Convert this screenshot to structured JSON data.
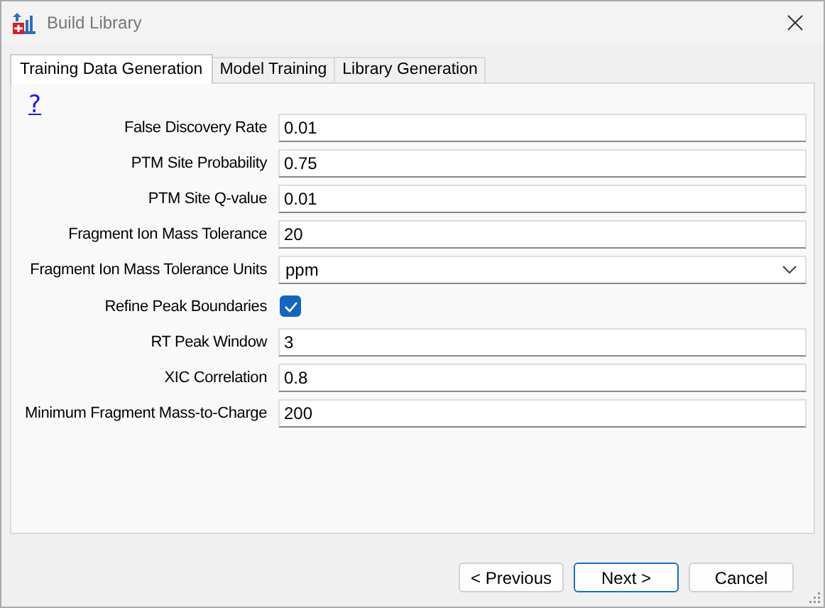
{
  "window": {
    "title": "Build Library"
  },
  "tabs": [
    {
      "label": "Training Data Generation",
      "selected": true
    },
    {
      "label": "Model Training",
      "selected": false
    },
    {
      "label": "Library Generation",
      "selected": false
    }
  ],
  "help_link": "?",
  "fields": [
    {
      "kind": "text",
      "label": "False Discovery Rate",
      "value": "0.01"
    },
    {
      "kind": "text",
      "label": "PTM Site Probability",
      "value": "0.75"
    },
    {
      "kind": "text",
      "label": "PTM Site Q-value",
      "value": "0.01"
    },
    {
      "kind": "text",
      "label": "Fragment Ion Mass Tolerance",
      "value": "20"
    },
    {
      "kind": "dropdown",
      "label": "Fragment Ion Mass Tolerance Units",
      "value": "ppm"
    },
    {
      "kind": "checkbox",
      "label": "Refine Peak Boundaries",
      "checked": true
    },
    {
      "kind": "text",
      "label": "RT Peak Window",
      "value": "3"
    },
    {
      "kind": "text",
      "label": "XIC Correlation",
      "value": "0.8"
    },
    {
      "kind": "text",
      "label": "Minimum Fragment Mass-to-Charge",
      "value": "200"
    }
  ],
  "buttons": [
    {
      "label": "< Previous",
      "selected": false
    },
    {
      "label": "Next >",
      "selected": true
    },
    {
      "label": "Cancel",
      "selected": false
    }
  ]
}
